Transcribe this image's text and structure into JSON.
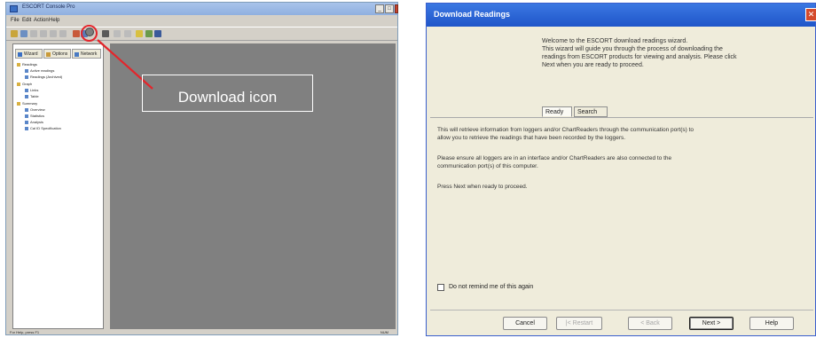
{
  "app": {
    "title": "ESCORT Console Pro",
    "menu": [
      "File",
      "Edit",
      "Action",
      "Help"
    ],
    "tree_tabs": [
      "Wizard",
      "Options",
      "Network"
    ],
    "tree": [
      {
        "label": "Readings",
        "level": 0
      },
      {
        "label": "Active readings",
        "level": 1
      },
      {
        "label": "Readings (Archived)",
        "level": 1
      },
      {
        "label": "Graph",
        "level": 0
      },
      {
        "label": "Links",
        "level": 1
      },
      {
        "label": "Table",
        "level": 1
      },
      {
        "label": "Summary",
        "level": 0
      },
      {
        "label": "Overview",
        "level": 1
      },
      {
        "label": "Statistics",
        "level": 1
      },
      {
        "label": "Analysis",
        "level": 1
      },
      {
        "label": "Cal ID Specification",
        "level": 1
      }
    ],
    "status_left": "For Help, press F1",
    "status_right": "NUM"
  },
  "callout": {
    "label": "Download icon"
  },
  "dialog": {
    "title": "Download Readings",
    "intro_lines": [
      "Welcome to the ESCORT download readings wizard.",
      "This wizard will guide you through the process of downloading the",
      "readings from ESCORT products for viewing and analysis. Please click",
      "Next when you are ready to proceed."
    ],
    "tabs": [
      "Ready",
      "Search"
    ],
    "paragraph1_lines": [
      "This will retrieve information from loggers and/or ChartReaders through the communication port(s) to",
      "allow you to retrieve the readings that have been recorded by the loggers."
    ],
    "paragraph2_lines": [
      "Please ensure all loggers are in an interface and/or ChartReaders are also connected to the",
      "communication port(s) of this computer."
    ],
    "paragraph3": "Press Next when ready to proceed.",
    "remind_label": "Do not remind me of this again",
    "buttons": {
      "cancel": "Cancel",
      "restart": "|< Restart",
      "back": "< Back",
      "next": "Next >",
      "help": "Help"
    }
  }
}
